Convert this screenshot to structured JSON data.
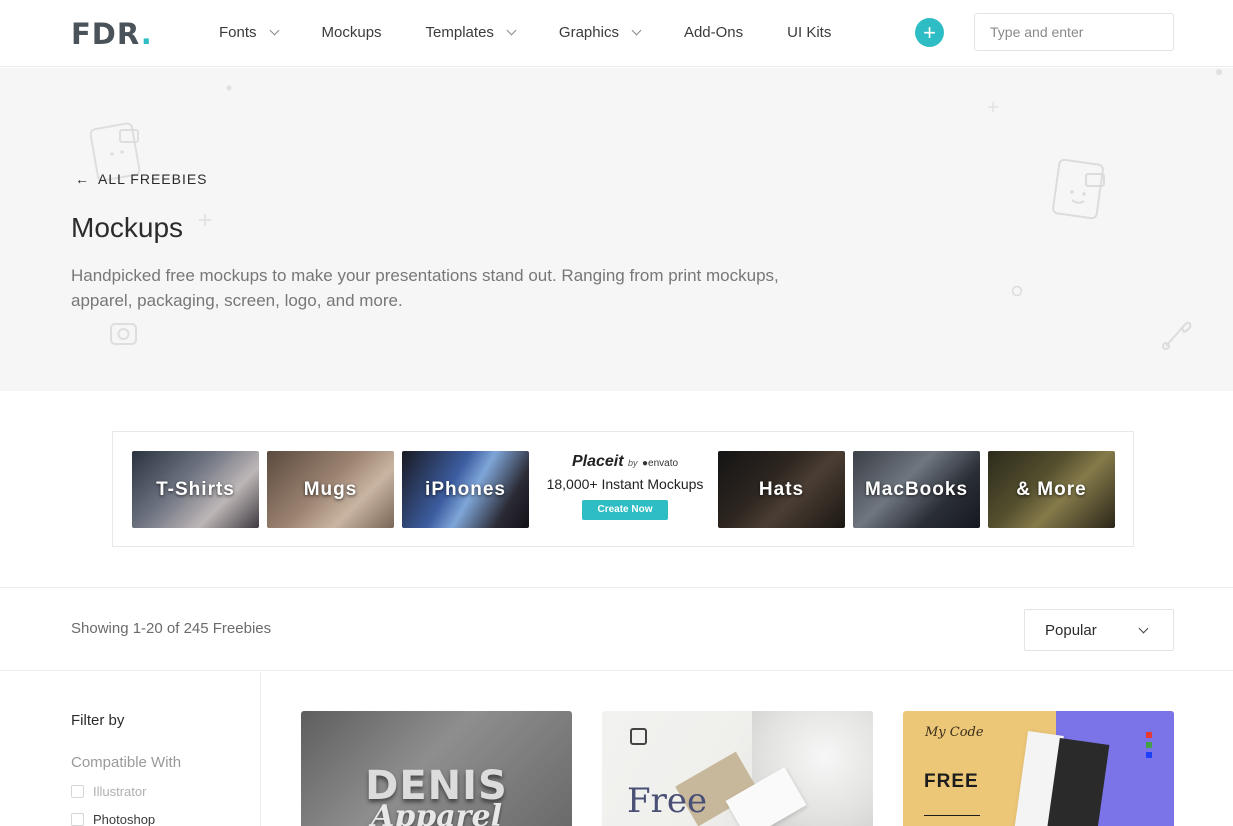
{
  "header": {
    "logo": "FDR",
    "logo_dot": ".",
    "nav": [
      {
        "label": "Fonts",
        "has_dropdown": true
      },
      {
        "label": "Mockups",
        "has_dropdown": false
      },
      {
        "label": "Templates",
        "has_dropdown": true
      },
      {
        "label": "Graphics",
        "has_dropdown": true
      },
      {
        "label": "Add-Ons",
        "has_dropdown": false
      },
      {
        "label": "UI Kits",
        "has_dropdown": false
      }
    ],
    "plus_icon": "+",
    "search_placeholder": "Type and enter",
    "accent_color": "#2ebdc4"
  },
  "hero": {
    "back_arrow": "←",
    "back_label": "ALL FREEBIES",
    "title": "Mockups",
    "description": "Handpicked free mockups to make your presentations stand out. Ranging from print mockups, apparel, packaging, screen, logo, and more."
  },
  "banner": {
    "tiles_left": [
      "T-Shirts",
      "Mugs",
      "iPhones"
    ],
    "tiles_right": [
      "Hats",
      "MacBooks",
      "& More"
    ],
    "placeit_logo": "Placeit",
    "placeit_by": "by",
    "placeit_envato": "●envato",
    "placeit_tagline": "18,000+ Instant Mockups",
    "placeit_button": "Create Now"
  },
  "results": {
    "showing": "Showing 1-20 of 245 Freebies",
    "sort_value": "Popular"
  },
  "sidebar": {
    "filter_title": "Filter by",
    "group_title": "Compatible With",
    "options": [
      "Illustrator",
      "Photoshop"
    ]
  },
  "cards": {
    "card1_title": "DENIS",
    "card1_subtitle": "Apparel",
    "card2_title": "Free",
    "card3_code": "My Code",
    "card3_title": "FREE"
  }
}
